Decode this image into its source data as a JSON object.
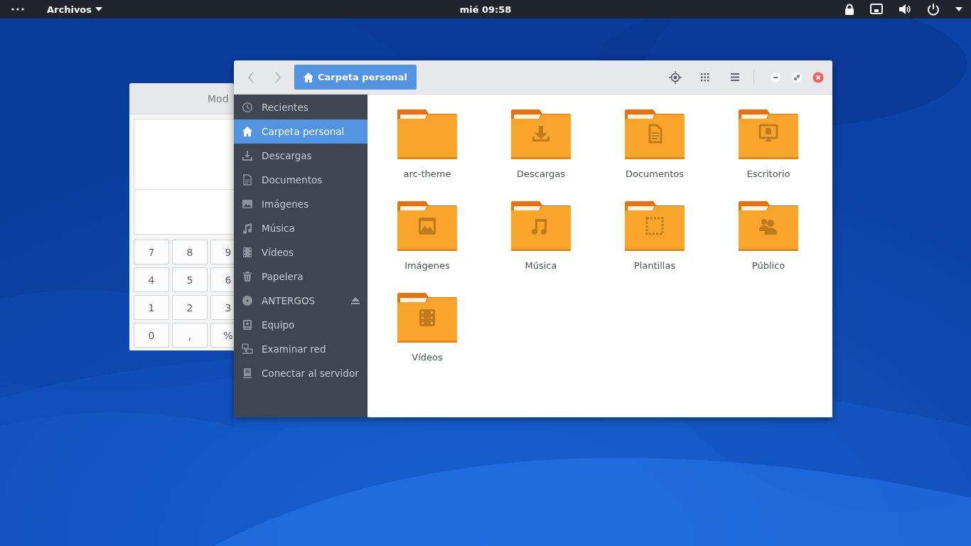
{
  "top_bar": {
    "app_menu": "Archivos",
    "clock": "mié 09:58"
  },
  "calculator": {
    "mode_label": "Mod",
    "keys": [
      [
        "7",
        "8",
        "9"
      ],
      [
        "4",
        "5",
        "6"
      ],
      [
        "1",
        "2",
        "3"
      ],
      [
        "0",
        ",",
        "%"
      ]
    ]
  },
  "files": {
    "nav": [
      {
        "kind": "back",
        "disabled": true
      },
      {
        "kind": "forward",
        "disabled": true
      }
    ],
    "location": "Carpeta personal",
    "sidebar": [
      {
        "label": "Recientes",
        "kind": "recent",
        "selected": false
      },
      {
        "label": "Carpeta personal",
        "kind": "home",
        "selected": true
      },
      {
        "label": "Descargas",
        "kind": "downloads",
        "selected": false
      },
      {
        "label": "Documentos",
        "kind": "documents",
        "selected": false
      },
      {
        "label": "Imágenes",
        "kind": "pictures",
        "selected": false
      },
      {
        "label": "Música",
        "kind": "music",
        "selected": false
      },
      {
        "label": "Vídeos",
        "kind": "videos",
        "selected": false
      },
      {
        "label": "Papelera",
        "kind": "trash",
        "selected": false
      },
      {
        "label": "ANTERGOS",
        "kind": "drive",
        "selected": false
      },
      {
        "label": "Equipo",
        "kind": "computer",
        "selected": false
      },
      {
        "label": "Examinar red",
        "kind": "network",
        "selected": false
      },
      {
        "label": "Conectar al servidor",
        "kind": "server",
        "selected": false
      }
    ],
    "folders": [
      {
        "name": "arc-theme",
        "kind": "plain"
      },
      {
        "name": "Descargas",
        "kind": "downloads"
      },
      {
        "name": "Documentos",
        "kind": "documents"
      },
      {
        "name": "Escritorio",
        "kind": "desktop"
      },
      {
        "name": "Imágenes",
        "kind": "pictures"
      },
      {
        "name": "Música",
        "kind": "music"
      },
      {
        "name": "Plantillas",
        "kind": "templates"
      },
      {
        "name": "Público",
        "kind": "public"
      },
      {
        "name": "Vídeos",
        "kind": "videos"
      }
    ]
  }
}
